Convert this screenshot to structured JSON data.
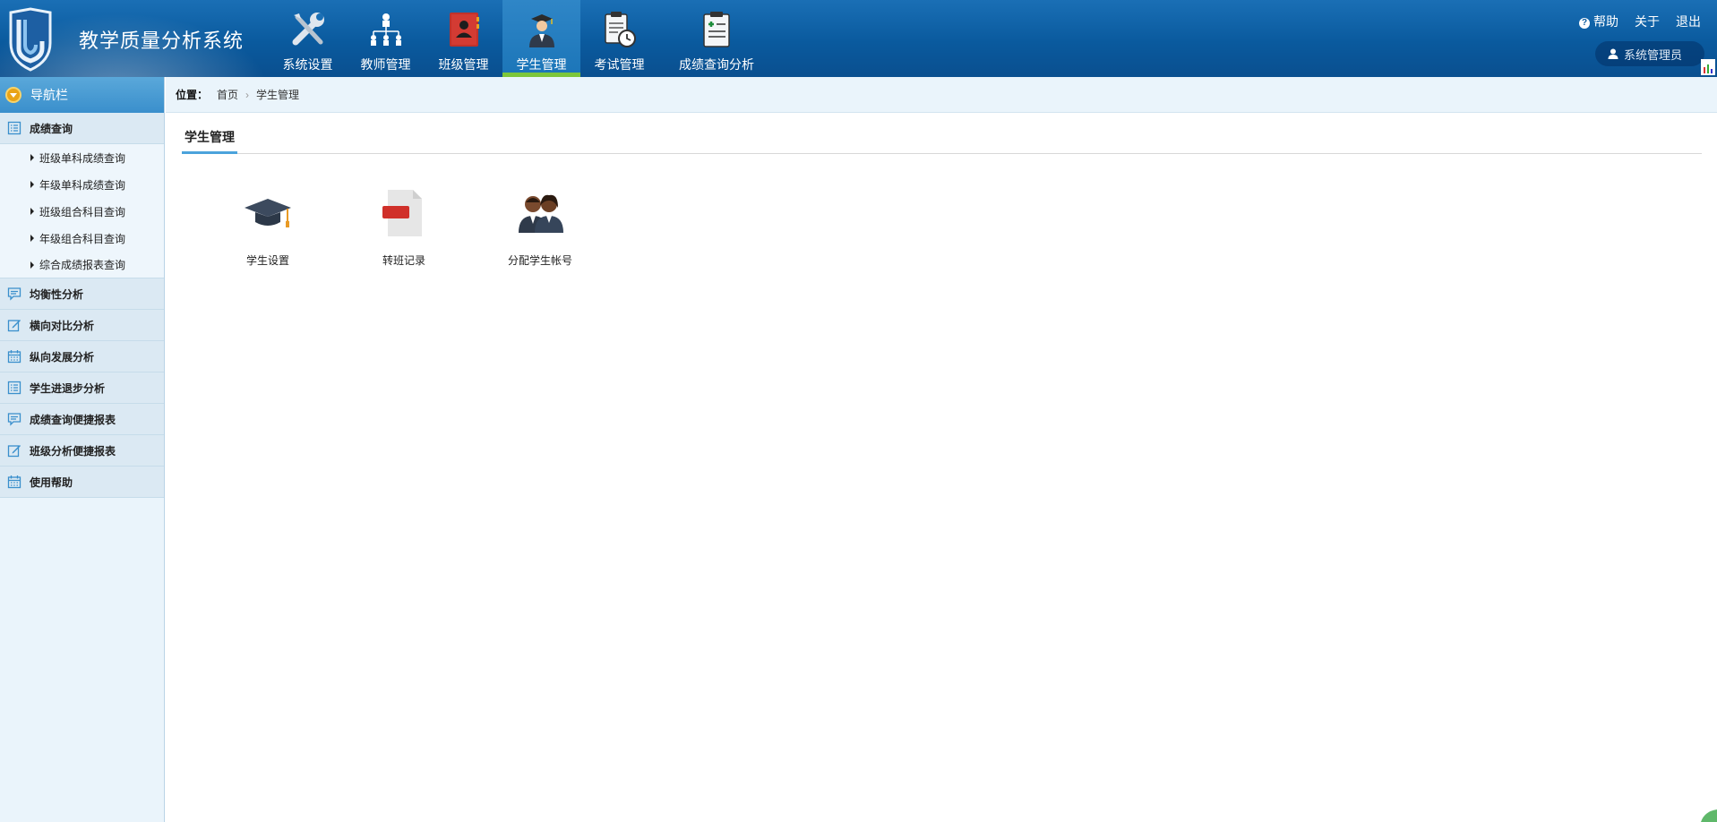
{
  "header": {
    "app_title": "教学质量分析系统",
    "nav": [
      {
        "label": "系统设置",
        "icon": "wrench-icon",
        "active": false
      },
      {
        "label": "教师管理",
        "icon": "org-chart-icon",
        "active": false
      },
      {
        "label": "班级管理",
        "icon": "contact-book-icon",
        "active": false
      },
      {
        "label": "学生管理",
        "icon": "student-icon",
        "active": true
      },
      {
        "label": "考试管理",
        "icon": "clipboard-clock-icon",
        "active": false
      },
      {
        "label": "成绩查询分析",
        "icon": "clipboard-plus-icon",
        "active": false
      }
    ],
    "links": {
      "help": "帮助",
      "about": "关于",
      "logout": "退出"
    },
    "user": "系统管理员"
  },
  "sidebar": {
    "title": "导航栏",
    "groups": [
      {
        "label": "成绩查询",
        "icon": "list-icon",
        "items": [
          "班级单科成绩查询",
          "年级单科成绩查询",
          "班级组合科目查询",
          "年级组合科目查询",
          "综合成绩报表查询"
        ]
      },
      {
        "label": "均衡性分析",
        "icon": "comment-icon"
      },
      {
        "label": "横向对比分析",
        "icon": "edit-icon"
      },
      {
        "label": "纵向发展分析",
        "icon": "calendar-icon"
      },
      {
        "label": "学生进退步分析",
        "icon": "list-icon"
      },
      {
        "label": "成绩查询便捷报表",
        "icon": "comment-icon"
      },
      {
        "label": "班级分析便捷报表",
        "icon": "edit-icon"
      },
      {
        "label": "使用帮助",
        "icon": "calendar-icon"
      }
    ]
  },
  "breadcrumb": {
    "label": "位置：",
    "home": "首页",
    "current": "学生管理"
  },
  "main": {
    "tab": "学生管理",
    "tiles": [
      {
        "label": "学生设置",
        "icon": "graduation-cap-icon"
      },
      {
        "label": "转班记录",
        "icon": "document-icon"
      },
      {
        "label": "分配学生帐号",
        "icon": "users-icon"
      }
    ]
  },
  "colors": {
    "header": "#0a5a9e",
    "active_underline": "#7cc63a",
    "sidebar_bg": "#eaf4fb",
    "tab_underline": "#4ba3dc"
  }
}
